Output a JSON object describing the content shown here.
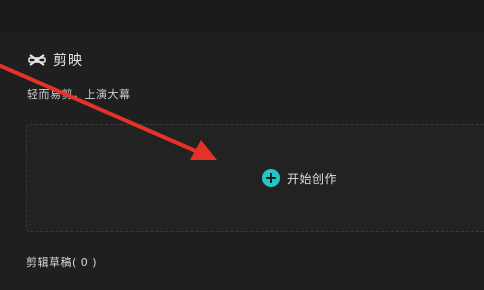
{
  "app": {
    "name": "剪映",
    "tagline": "轻而易剪，上演大幕",
    "logo_icon": "capcut-logo-icon"
  },
  "create": {
    "label": "开始创作",
    "icon": "plus-circle-icon",
    "accent_color": "#1fc7c7"
  },
  "drafts": {
    "title": "剪辑草稿( 0 )"
  },
  "annotation": {
    "arrow_color": "#e53228"
  }
}
